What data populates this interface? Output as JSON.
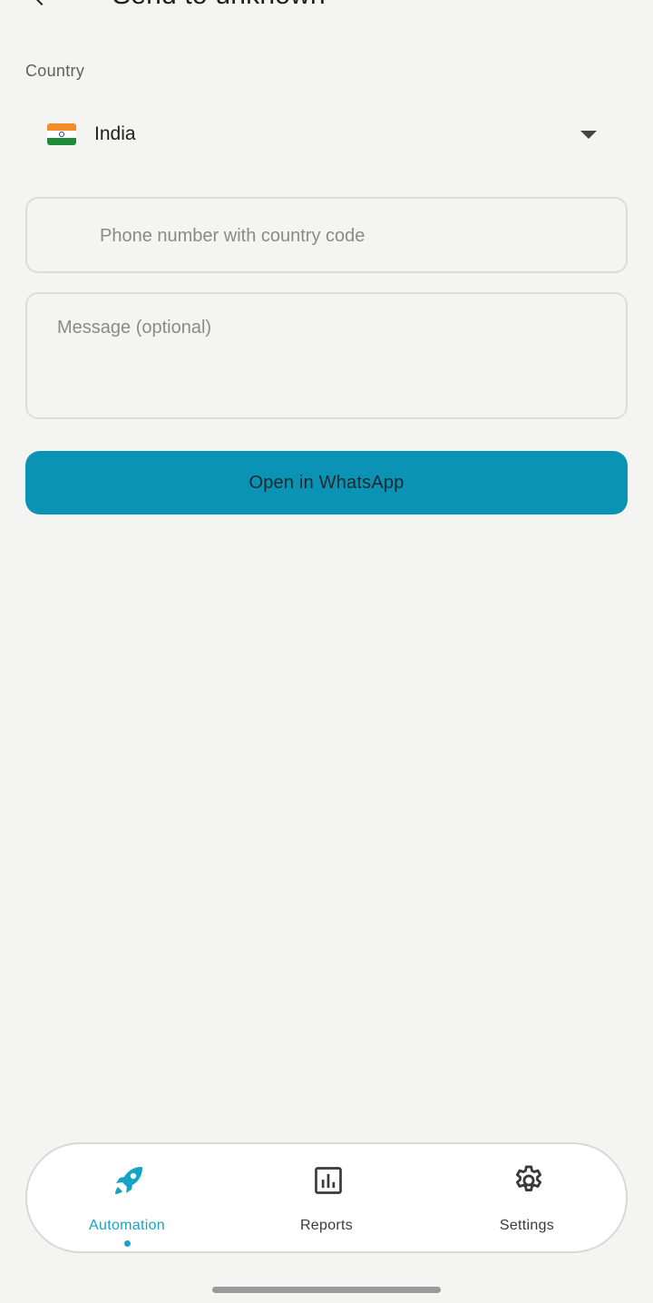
{
  "header": {
    "title": "Send to unknown",
    "back_icon": "back-arrow-icon"
  },
  "country": {
    "label": "Country",
    "selected": "India",
    "flag_icon": "india-flag-icon",
    "dropdown_icon": "chevron-down-icon"
  },
  "phone": {
    "placeholder": "Phone number with country code",
    "value": ""
  },
  "message": {
    "placeholder": "Message (optional)",
    "value": ""
  },
  "action": {
    "open_label": "Open in WhatsApp",
    "color": "#0b93b5"
  },
  "bottom_nav": {
    "active_color": "#16a4c4",
    "items": [
      {
        "label": "Automation",
        "icon": "rocket-icon",
        "active": true
      },
      {
        "label": "Reports",
        "icon": "bar-chart-icon",
        "active": false
      },
      {
        "label": "Settings",
        "icon": "gear-icon",
        "active": false
      }
    ]
  }
}
